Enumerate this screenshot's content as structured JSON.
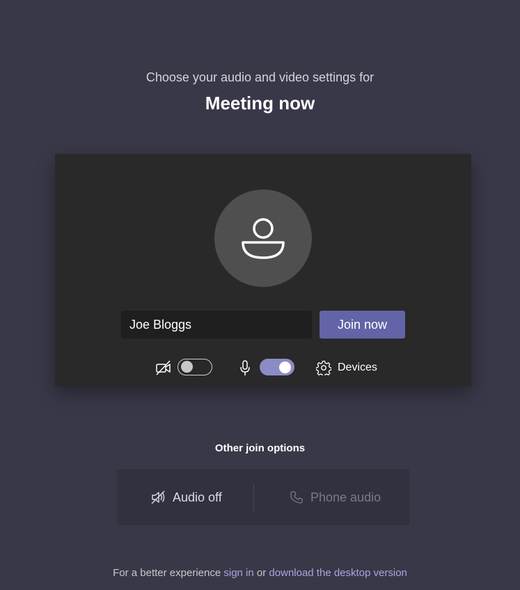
{
  "header": {
    "subtitle": "Choose your audio and video settings for",
    "meeting_title": "Meeting now"
  },
  "preview": {
    "avatar_icon": "person-icon",
    "name_value": "Joe Bloggs",
    "join_label": "Join now",
    "camera": {
      "icon": "camera-off-icon",
      "enabled": false
    },
    "microphone": {
      "icon": "microphone-icon",
      "enabled": true
    },
    "devices": {
      "icon": "gear-icon",
      "label": "Devices"
    }
  },
  "other_options": {
    "title": "Other join options",
    "audio_off": {
      "icon": "speaker-off-icon",
      "label": "Audio off"
    },
    "phone_audio": {
      "icon": "phone-icon",
      "label": "Phone audio"
    }
  },
  "footer": {
    "prefix": "For a better experience ",
    "sign_in": "sign in",
    "middle": " or ",
    "download": "download the desktop version"
  },
  "colors": {
    "background": "#393848",
    "card": "#292929",
    "accent": "#6264a7",
    "toggle_on": "#8b8cc7",
    "link": "#a6a7dc"
  }
}
